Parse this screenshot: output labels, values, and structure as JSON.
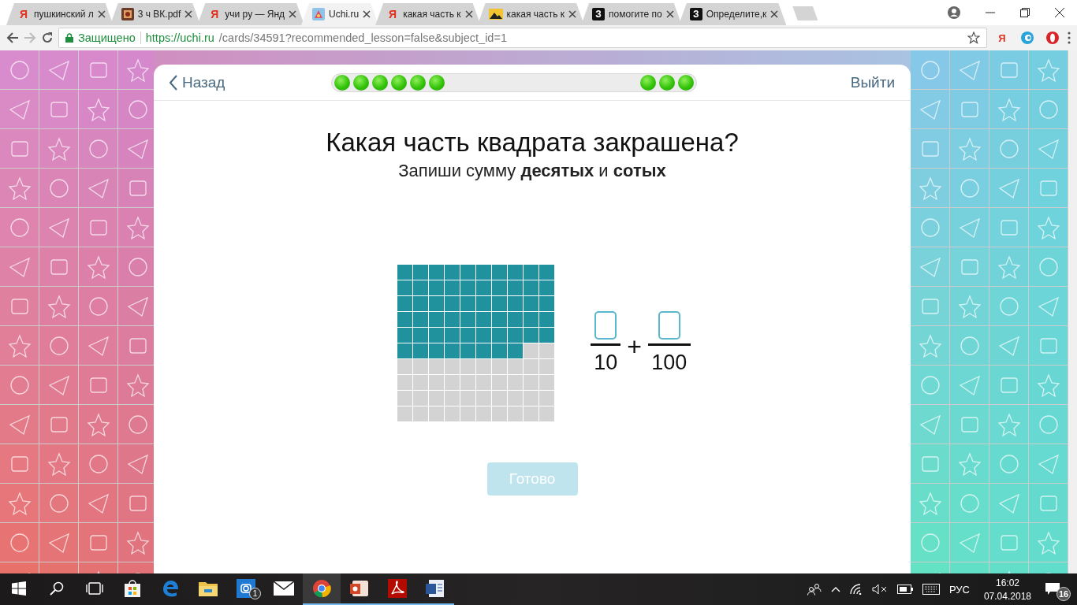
{
  "browser": {
    "tabs": [
      {
        "title": "пушкинский л",
        "kind": "yandex",
        "icon_text": "Я",
        "selected": false
      },
      {
        "title": "3 ч ВК.pdf",
        "kind": "photo",
        "selected": false
      },
      {
        "title": "учи ру — Янд",
        "kind": "yandex",
        "icon_text": "Я",
        "selected": false
      },
      {
        "title": "Uchi.ru",
        "kind": "uchi",
        "selected": true
      },
      {
        "title": "какая часть к",
        "kind": "yandex",
        "icon_text": "Я",
        "selected": false
      },
      {
        "title": "какая часть к",
        "kind": "image",
        "selected": false
      },
      {
        "title": "помогите по",
        "kind": "znanija",
        "icon_text": "З",
        "selected": false
      },
      {
        "title": "Определите,к",
        "kind": "znanija",
        "icon_text": "З",
        "selected": false
      }
    ],
    "address": {
      "secure_label": "Защищено",
      "url_host": "https://uchi.ru",
      "url_path": "/cards/34591?recommended_lesson=false&subject_id=1"
    },
    "extensions": [
      {
        "kind": "yandex",
        "icon_text": "Я"
      },
      {
        "kind": "swirl"
      },
      {
        "kind": "opera"
      }
    ]
  },
  "lesson": {
    "back": "Назад",
    "exit": "Выйти",
    "progress_dots": [
      {
        "kind": "start"
      },
      {
        "kind": "start"
      },
      {
        "kind": "start"
      },
      {
        "kind": "start"
      },
      {
        "kind": "start"
      },
      {
        "kind": "start"
      },
      {
        "kind": "end"
      },
      {
        "kind": "end"
      },
      {
        "kind": "end"
      }
    ],
    "question": "Какая часть квадрата закрашена?",
    "instruction": "Запиши сумму **десятых** и **сотых**",
    "grid": [
      [
        true,
        true,
        true,
        true,
        true,
        true,
        true,
        true,
        true,
        true
      ],
      [
        true,
        true,
        true,
        true,
        true,
        true,
        true,
        true,
        true,
        true
      ],
      [
        true,
        true,
        true,
        true,
        true,
        true,
        true,
        true,
        true,
        true
      ],
      [
        true,
        true,
        true,
        true,
        true,
        true,
        true,
        true,
        true,
        true
      ],
      [
        true,
        true,
        true,
        true,
        true,
        true,
        true,
        true,
        true,
        true
      ],
      [
        true,
        true,
        true,
        true,
        true,
        true,
        true,
        true,
        false,
        false
      ],
      [
        false,
        false,
        false,
        false,
        false,
        false,
        false,
        false,
        false,
        false
      ],
      [
        false,
        false,
        false,
        false,
        false,
        false,
        false,
        false,
        false,
        false
      ],
      [
        false,
        false,
        false,
        false,
        false,
        false,
        false,
        false,
        false,
        false
      ],
      [
        false,
        false,
        false,
        false,
        false,
        false,
        false,
        false,
        false,
        false
      ]
    ],
    "answer": {
      "terms": [
        {
          "denominator": "10"
        },
        {
          "denominator": "100"
        }
      ],
      "operator": "+"
    },
    "submit": {
      "label": "Готово",
      "disabled": true
    }
  },
  "taskbar": {
    "apps": [
      {
        "kind": "start",
        "running": false,
        "active": false
      },
      {
        "kind": "search",
        "running": false,
        "active": false
      },
      {
        "kind": "task-view",
        "running": false,
        "active": false
      },
      {
        "kind": "store",
        "running": false,
        "active": false
      },
      {
        "kind": "edge",
        "running": false,
        "active": false
      },
      {
        "kind": "folder",
        "running": false,
        "active": false
      },
      {
        "kind": "camera",
        "running": false,
        "active": false,
        "badge": "1"
      },
      {
        "kind": "mail",
        "running": false,
        "active": false
      },
      {
        "kind": "chrome",
        "running": true,
        "active": true
      },
      {
        "kind": "slides",
        "running": true,
        "active": false
      },
      {
        "kind": "pdf",
        "running": true,
        "active": false
      },
      {
        "kind": "doc",
        "running": true,
        "active": false
      }
    ],
    "tray": {
      "language": "РУС",
      "time": "16:02",
      "date": "07.04.2018",
      "notifications": "16"
    }
  }
}
